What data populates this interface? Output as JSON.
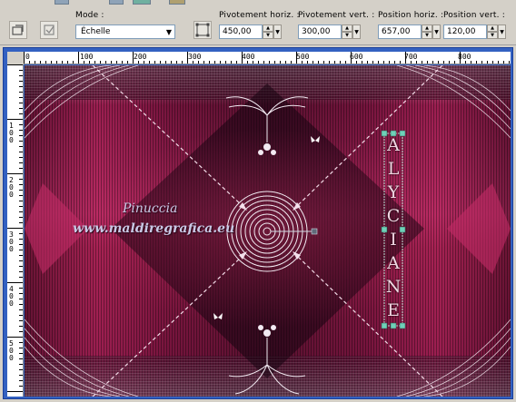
{
  "toolbar": {
    "mode_label": "Mode :",
    "mode_value": "Échelle",
    "pivot_h_label": "Pivotement horiz. :",
    "pivot_h_value": "450,00",
    "pivot_v_label": "Pivotement vert. :",
    "pivot_v_value": "300,00",
    "pos_h_label": "Position horiz. :",
    "pos_h_value": "657,00",
    "pos_v_label": "Position vert. :",
    "pos_v_value": "120,00"
  },
  "ruler": {
    "h_ticks": [
      "0",
      "100",
      "200",
      "300",
      "400",
      "500",
      "600",
      "700",
      "800"
    ],
    "v_ticks": [
      "100",
      "200",
      "300",
      "400",
      "500"
    ]
  },
  "canvas": {
    "watermark_line1": "Pinuccia",
    "watermark_line2": "www.maldiregrafica.eu",
    "vertical_text": [
      "A",
      "L",
      "Y",
      "C",
      "I",
      "A",
      "N",
      "E"
    ]
  },
  "colors": {
    "magenta": "#a01a4c",
    "dark": "#1a0510",
    "frame_blue": "#3361c1"
  }
}
